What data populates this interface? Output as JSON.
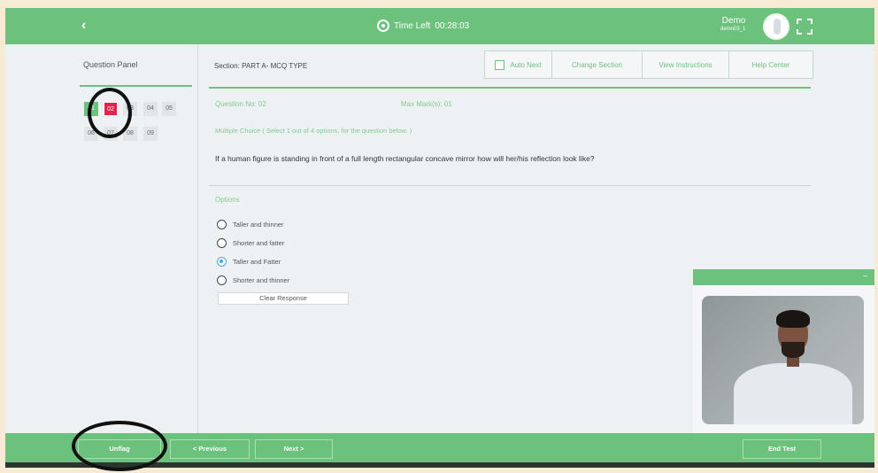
{
  "header": {
    "back_icon": "chevron-left-icon",
    "timer_icon": "eye-icon",
    "timer_label": "Time Left",
    "timer_value": "00:28:03",
    "user_name": "Demo",
    "user_id": "demo03_1",
    "fullscreen_icon": "fullscreen-icon",
    "bar_color": "#6cc17d"
  },
  "question_panel": {
    "title": "Question Panel",
    "numbers": [
      "01",
      "02",
      "03",
      "04",
      "05",
      "06",
      "07",
      "08",
      "09"
    ],
    "current": "02",
    "current_color": "#e5224a"
  },
  "section": {
    "label": "Section: PART A- MCQ TYPE"
  },
  "toolbar": {
    "auto_next": "Auto Next",
    "change_section": "Change Section",
    "view_instructions": "View Instructions",
    "help_center": "Help Center"
  },
  "question": {
    "number": "Question No: 02",
    "max_marks": "Max Mark(s): 01",
    "type": "Multiple Choice ( Select 1 out of 4 options, for the question below. )",
    "text": "If a human figure is standing in front of a full length rectangular concave mirror how will her/his reflection look like?"
  },
  "options": {
    "label": "Options",
    "items": [
      {
        "text": "Taller and thinner",
        "selected": false
      },
      {
        "text": "Shorter and fatter",
        "selected": false
      },
      {
        "text": "Taller and Fatter",
        "selected": true
      },
      {
        "text": "Shorter and thinner",
        "selected": false
      }
    ],
    "clear_label": "Clear Response"
  },
  "camera": {
    "minimize_icon": "minimize-icon"
  },
  "footer": {
    "unflag": "Unflag",
    "previous": "< Previous",
    "next": "Next >",
    "end_test": "End Test"
  }
}
